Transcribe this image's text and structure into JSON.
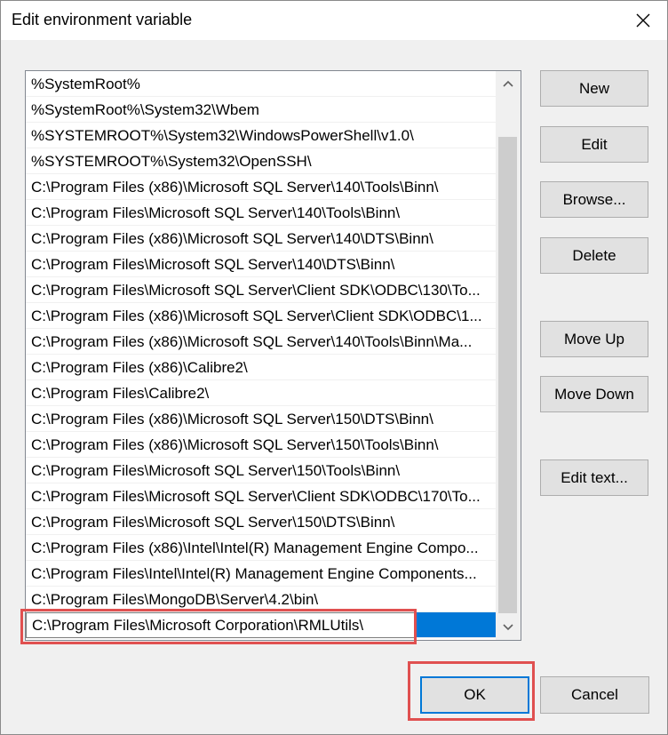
{
  "window": {
    "title": "Edit environment variable",
    "close_icon": "close-icon"
  },
  "paths": [
    "%SystemRoot%",
    "%SystemRoot%\\System32\\Wbem",
    "%SYSTEMROOT%\\System32\\WindowsPowerShell\\v1.0\\",
    "%SYSTEMROOT%\\System32\\OpenSSH\\",
    "C:\\Program Files (x86)\\Microsoft SQL Server\\140\\Tools\\Binn\\",
    "C:\\Program Files\\Microsoft SQL Server\\140\\Tools\\Binn\\",
    "C:\\Program Files (x86)\\Microsoft SQL Server\\140\\DTS\\Binn\\",
    "C:\\Program Files\\Microsoft SQL Server\\140\\DTS\\Binn\\",
    "C:\\Program Files\\Microsoft SQL Server\\Client SDK\\ODBC\\130\\To...",
    "C:\\Program Files (x86)\\Microsoft SQL Server\\Client SDK\\ODBC\\1...",
    "C:\\Program Files (x86)\\Microsoft SQL Server\\140\\Tools\\Binn\\Ma...",
    "C:\\Program Files (x86)\\Calibre2\\",
    "C:\\Program Files\\Calibre2\\",
    "C:\\Program Files (x86)\\Microsoft SQL Server\\150\\DTS\\Binn\\",
    "C:\\Program Files (x86)\\Microsoft SQL Server\\150\\Tools\\Binn\\",
    "C:\\Program Files\\Microsoft SQL Server\\150\\Tools\\Binn\\",
    "C:\\Program Files\\Microsoft SQL Server\\Client SDK\\ODBC\\170\\To...",
    "C:\\Program Files\\Microsoft SQL Server\\150\\DTS\\Binn\\",
    "C:\\Program Files (x86)\\Intel\\Intel(R) Management Engine Compo...",
    "C:\\Program Files\\Intel\\Intel(R) Management Engine Components...",
    "C:\\Program Files\\MongoDB\\Server\\4.2\\bin\\"
  ],
  "editing_value": "C:\\Program Files\\Microsoft Corporation\\RMLUtils\\",
  "buttons": {
    "new": "New",
    "edit": "Edit",
    "browse": "Browse...",
    "delete": "Delete",
    "move_up": "Move Up",
    "move_down": "Move Down",
    "edit_text": "Edit text...",
    "ok": "OK",
    "cancel": "Cancel"
  },
  "colors": {
    "selection": "#0078d7",
    "highlight_box": "#e05050",
    "dialog_bg": "#f0f0f0"
  }
}
